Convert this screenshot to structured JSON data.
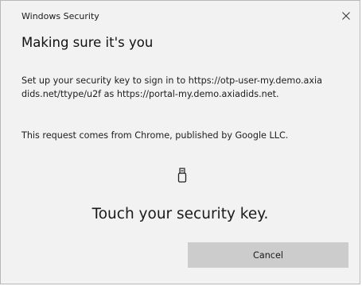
{
  "window": {
    "title": "Windows Security"
  },
  "dialog": {
    "heading": "Making sure it's you",
    "description": "Set up your security key to sign in to https://otp-user-my.demo.axiadids.net/ttype/u2f as https://portal-my.demo.axiadids.net.",
    "origin": "This request comes from Chrome, published by Google LLC.",
    "icon": "usb-security-key-icon",
    "prompt": "Touch your security key.",
    "cancel_label": "Cancel"
  },
  "colors": {
    "background": "#f2f2f2",
    "button": "#cccccc",
    "text": "#1f1f1f"
  }
}
